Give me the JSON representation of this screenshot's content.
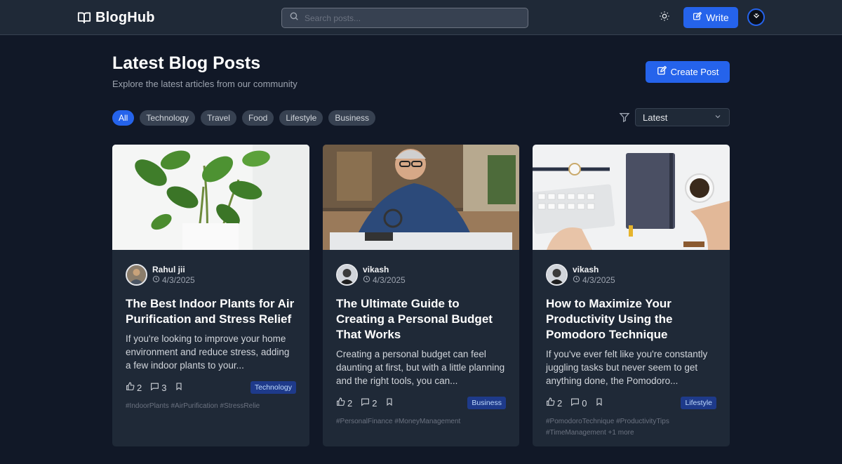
{
  "navbar": {
    "brand": "BlogHub",
    "search_placeholder": "Search posts...",
    "write_label": "Write"
  },
  "header": {
    "title": "Latest Blog Posts",
    "subtitle": "Explore the latest articles from our community",
    "create_label": "Create Post"
  },
  "filters": {
    "categories": [
      "All",
      "Technology",
      "Travel",
      "Food",
      "Lifestyle",
      "Business"
    ],
    "active": "All",
    "sort_value": "Latest"
  },
  "posts": [
    {
      "author": "Rahul jii",
      "date": "4/3/2025",
      "title": "The Best Indoor Plants for Air Purification and Stress Relief",
      "excerpt": "If you're looking to improve your home environment and reduce stress, adding a few indoor plants to your...",
      "likes": "2",
      "comments": "3",
      "category": "Technology",
      "tags": "#IndoorPlants #AirPurification #StressRelie",
      "image": "houseplant-icon"
    },
    {
      "author": "vikash",
      "date": "4/3/2025",
      "title": "The Ultimate Guide to Creating a Personal Budget That Works",
      "excerpt": "Creating a personal budget can feel daunting at first, but with a little planning and the right tools, you can...",
      "likes": "2",
      "comments": "2",
      "category": "Business",
      "tags": "#PersonalFinance #MoneyManagement",
      "image": "man-with-magnifier-icon"
    },
    {
      "author": "vikash",
      "date": "4/3/2025",
      "title": "How to Maximize Your Productivity Using the Pomodoro Technique",
      "excerpt": "If you've ever felt like you're constantly juggling tasks but never seem to get anything done, the Pomodoro...",
      "likes": "2",
      "comments": "0",
      "category": "Lifestyle",
      "tags": "#PomodoroTechnique #ProductivityTips #TimeManagement +1 more",
      "image": "desk-workspace-icon"
    }
  ],
  "colors": {
    "background": "#111827",
    "surface": "#1f2937",
    "accent": "#2563eb",
    "badge": "#1e3a8a"
  }
}
